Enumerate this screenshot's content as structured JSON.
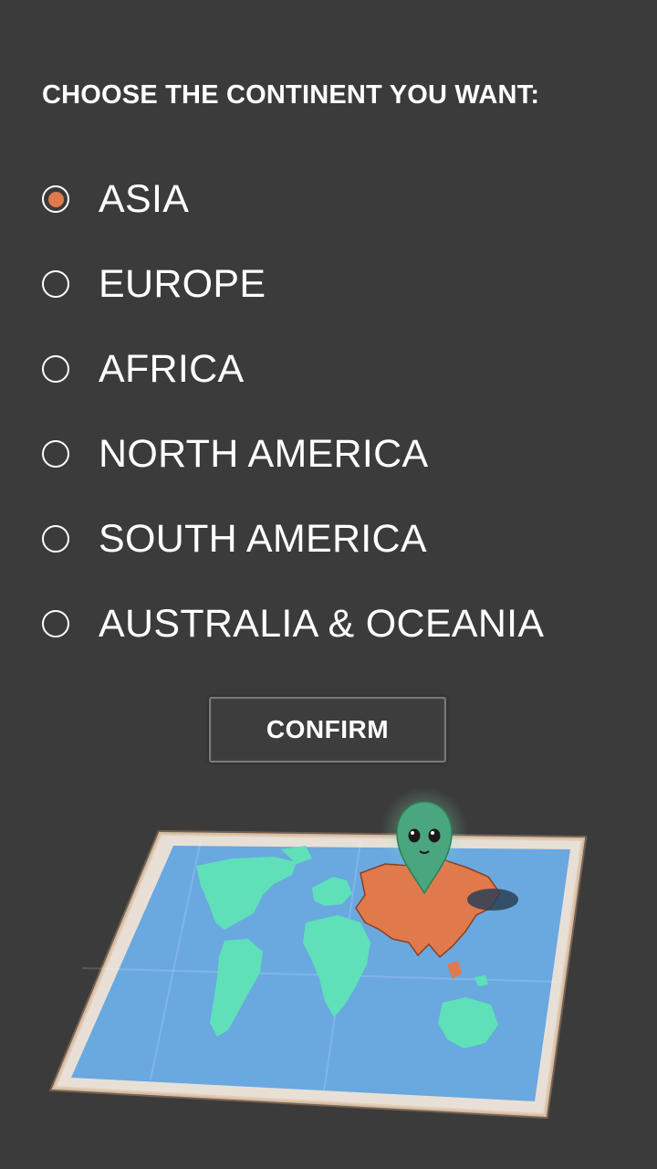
{
  "prompt": {
    "title": "CHOOSE THE CONTINENT YOU WANT:"
  },
  "options": [
    {
      "label": "ASIA",
      "selected": true
    },
    {
      "label": "EUROPE",
      "selected": false
    },
    {
      "label": "AFRICA",
      "selected": false
    },
    {
      "label": "NORTH AMERICA",
      "selected": false
    },
    {
      "label": "SOUTH AMERICA",
      "selected": false
    },
    {
      "label": "AUSTRALIA & OCEANIA",
      "selected": false
    }
  ],
  "confirm": {
    "label": "CONFIRM"
  },
  "colors": {
    "background": "#3b3b3b",
    "accent": "#e07a4c",
    "ocean": "#6aa8e0",
    "land": "#5fe0b8",
    "pin": "#4aa67e"
  },
  "illustration": {
    "icons": [
      "world-map-icon",
      "alien-pin-icon"
    ]
  }
}
